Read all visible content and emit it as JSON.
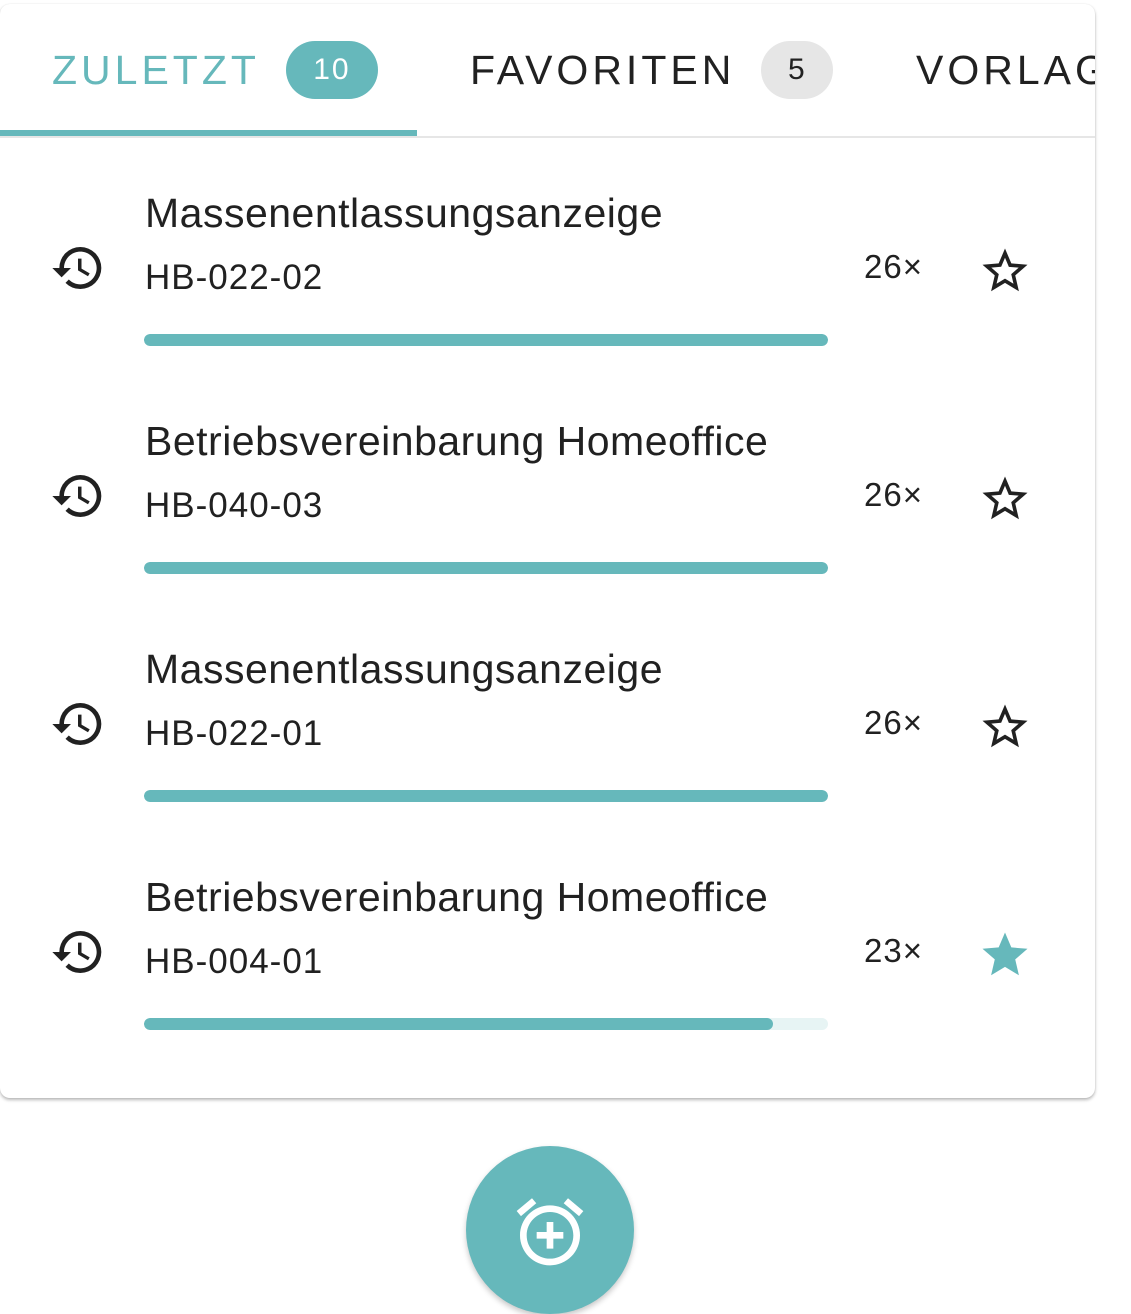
{
  "tabs": [
    {
      "label": "ZULETZT",
      "badge": "10",
      "active": true
    },
    {
      "label": "FAVORITEN",
      "badge": "5",
      "active": false
    },
    {
      "label": "VORLAG",
      "badge": "",
      "active": false
    }
  ],
  "items": [
    {
      "title": "Massenentlassungsanzeige",
      "code": "HB-022-02",
      "count": "26×",
      "progress": 1.0,
      "favorite": false,
      "icon": "history-icon"
    },
    {
      "title": "Betriebsvereinbarung Homeoffice",
      "code": "HB-040-03",
      "count": "26×",
      "progress": 1.0,
      "favorite": false,
      "icon": "history-icon"
    },
    {
      "title": "Massenentlassungsanzeige",
      "code": "HB-022-01",
      "count": "26×",
      "progress": 1.0,
      "favorite": false,
      "icon": "history-icon"
    },
    {
      "title": "Betriebsvereinbarung Homeoffice",
      "code": "HB-004-01",
      "count": "23×",
      "progress": 0.92,
      "favorite": true,
      "icon": "history-icon"
    }
  ],
  "fab": {
    "icon": "add-alarm-icon"
  },
  "colors": {
    "accent": "#66b8bb",
    "text": "#212121",
    "badge_inactive": "#e6e6e6",
    "track": "#e7f4f4"
  }
}
